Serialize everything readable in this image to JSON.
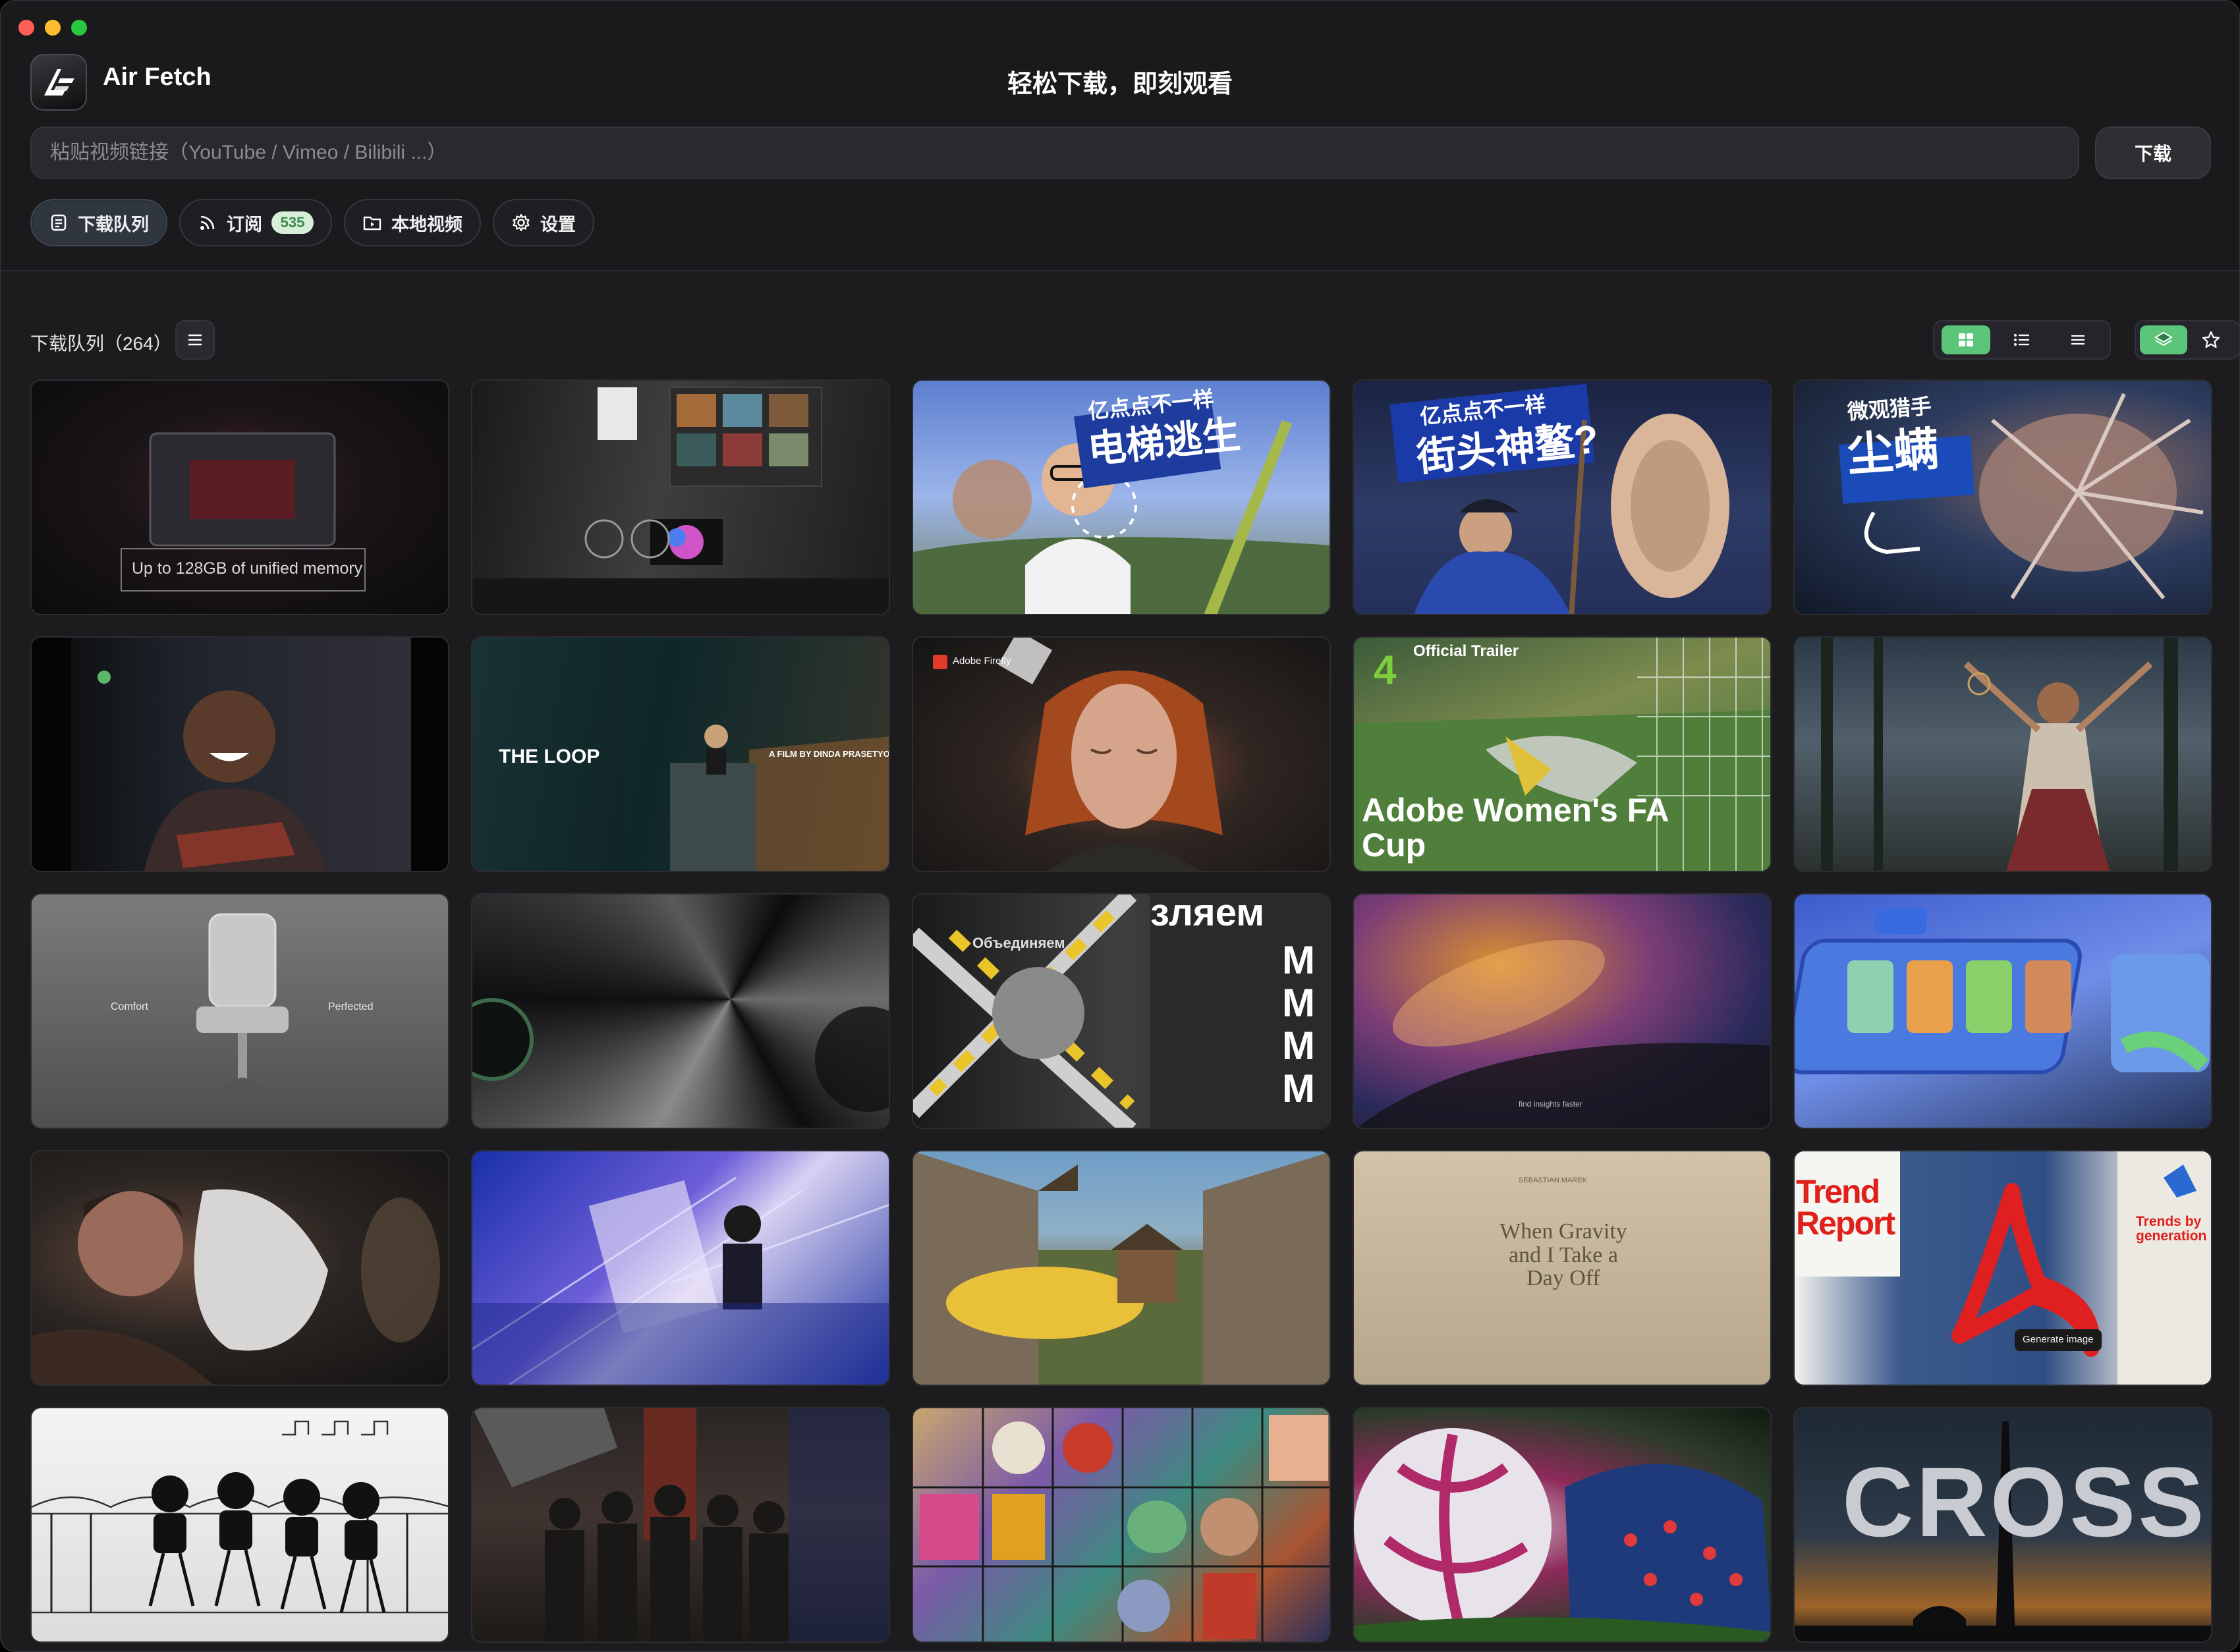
{
  "app": {
    "name": "Air Fetch",
    "slogan": "轻松下载，即刻观看"
  },
  "url_input": {
    "placeholder": "粘贴视频链接（YouTube / Vimeo / Bilibili ...）",
    "value": ""
  },
  "download_button": {
    "label": "下载"
  },
  "tabs": [
    {
      "label": "下载队列",
      "icon": "queue-icon",
      "active": true
    },
    {
      "label": "订阅",
      "icon": "rss-icon",
      "badge": "535"
    },
    {
      "label": "本地视频",
      "icon": "folder-icon"
    },
    {
      "label": "设置",
      "icon": "gear-icon"
    }
  ],
  "queue": {
    "title": "下载队列（264）"
  },
  "view_modes": [
    {
      "name": "grid-view",
      "active": true
    },
    {
      "name": "list-view"
    },
    {
      "name": "compact-view"
    }
  ],
  "colors": {
    "accent": "#5bc57a",
    "badge_bg": "#d8eed8",
    "badge_text": "#3c8a4f",
    "window_bg": "#1c1c1f"
  },
  "thumbnails": [
    {
      "caption": "Up to 128GB of unified memory"
    },
    {
      "caption": ""
    },
    {
      "caption": "亿点点不一样",
      "caption2": "电梯逃生"
    },
    {
      "caption": "亿点点不一样",
      "caption2": "街头神鳌?"
    },
    {
      "caption": "微观猎手",
      "caption2": "尘螨"
    },
    {
      "caption": ""
    },
    {
      "caption": "THE LOOP",
      "caption2": "A FILM BY DINDA PRASETYO"
    },
    {
      "caption": "Adobe Firefly"
    },
    {
      "caption": "Official Trailer",
      "caption2": "Adobe Women's FA Cup"
    },
    {
      "caption": ""
    },
    {
      "caption": "Comfort",
      "caption2": "Perfected"
    },
    {
      "caption": ""
    },
    {
      "caption": "Объединяем",
      "caption2": "зляем"
    },
    {
      "caption": "find insights faster"
    },
    {
      "caption": ""
    },
    {
      "caption": ""
    },
    {
      "caption": ""
    },
    {
      "caption": ""
    },
    {
      "caption": "When Gravity and I Take a Day Off",
      "caption2": "SEBASTIAN MAREK"
    },
    {
      "caption": "Trend Report",
      "caption2": "Trends by generation",
      "caption3": "Generate image"
    },
    {
      "caption": ""
    },
    {
      "caption": ""
    },
    {
      "caption": ""
    },
    {
      "caption": ""
    },
    {
      "caption": "CROSS"
    }
  ]
}
